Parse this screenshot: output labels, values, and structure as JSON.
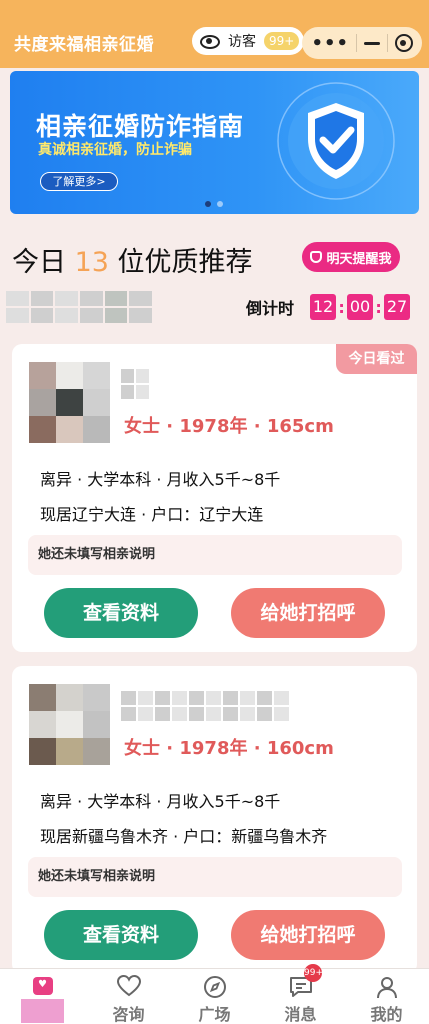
{
  "header": {
    "title": "共度来福相亲征婚",
    "visitor_label": "访客",
    "visitor_badge": "99+",
    "bg_color": "#f6b45c"
  },
  "banner": {
    "title": "相亲征婚防诈指南",
    "subtitle": "真诚相亲征婚，防止诈骗",
    "button_label": "了解更多>",
    "icon": "shield-check-icon"
  },
  "recommend": {
    "prefix": "今日",
    "count": "13",
    "suffix": "位优质推荐",
    "remind_label": "明天提醒我",
    "countdown_label": "倒计时",
    "countdown": {
      "h": "12",
      "m": "00",
      "s": "27"
    }
  },
  "cards": [
    {
      "seen_tag": "今日看过",
      "basic": "女士 · 1978年 · 165cm",
      "line1": "离异 · 大学本科 · 月收入5千~8千",
      "line2": "现居辽宁大连 · 户口：辽宁大连",
      "note": "她还未填写相亲说明",
      "view_label": "查看资料",
      "greet_label": "给她打招呼"
    },
    {
      "basic": "女士 · 1978年 · 160cm",
      "line1": "离异 · 大学本科 · 月收入5千~8千",
      "line2": "现居新疆乌鲁木齐 · 户口：新疆乌鲁木齐",
      "note": "她还未填写相亲说明",
      "view_label": "查看资料",
      "greet_label": "给她打招呼"
    }
  ],
  "tabbar": {
    "items": [
      {
        "label": "",
        "icon": "home-heart-icon"
      },
      {
        "label": "咨询",
        "icon": "heart-icon"
      },
      {
        "label": "广场",
        "icon": "compass-icon"
      },
      {
        "label": "消息",
        "icon": "message-icon"
      },
      {
        "label": "我的",
        "icon": "user-icon"
      }
    ],
    "message_badge": "99+"
  },
  "colors": {
    "accent_pink": "#ec2b84",
    "accent_orange": "#f5a356",
    "green_button": "#239e79",
    "coral_button": "#f07a72"
  }
}
